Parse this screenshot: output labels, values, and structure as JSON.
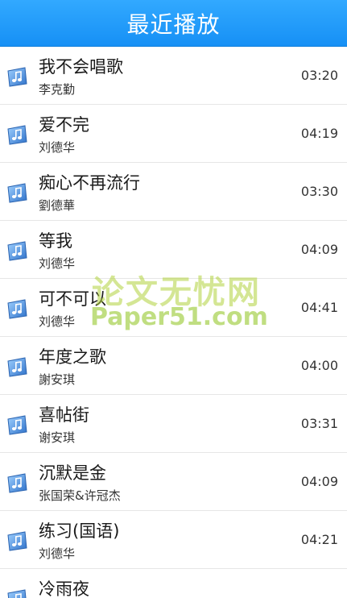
{
  "header": {
    "title": "最近播放"
  },
  "songs": [
    {
      "title": "我不会唱歌",
      "artist": "李克勤",
      "duration": "03:20"
    },
    {
      "title": "爱不完",
      "artist": "刘德华",
      "duration": "04:19"
    },
    {
      "title": "痴心不再流行",
      "artist": "劉德華",
      "duration": "03:30"
    },
    {
      "title": "等我",
      "artist": "刘德华",
      "duration": "04:09"
    },
    {
      "title": "可不可以",
      "artist": "刘德华",
      "duration": "04:41"
    },
    {
      "title": "年度之歌",
      "artist": "謝安琪",
      "duration": "04:00"
    },
    {
      "title": "喜帖街",
      "artist": "谢安琪",
      "duration": "03:31"
    },
    {
      "title": "沉默是金",
      "artist": "张国荣&许冠杰",
      "duration": "04:09"
    },
    {
      "title": "练习(国语)",
      "artist": "刘德华",
      "duration": "04:21"
    },
    {
      "title": "冷雨夜",
      "artist": "",
      "duration": ""
    }
  ],
  "watermark": {
    "cn": "论文无忧网",
    "en": "Paper51.com"
  },
  "colors": {
    "header_bg": "#1f9bfa",
    "header_text": "#ffffff",
    "divider": "#e6e6e6",
    "icon_blue": "#3d84d8"
  },
  "icons": {
    "song_icon": "music-note-icon"
  }
}
